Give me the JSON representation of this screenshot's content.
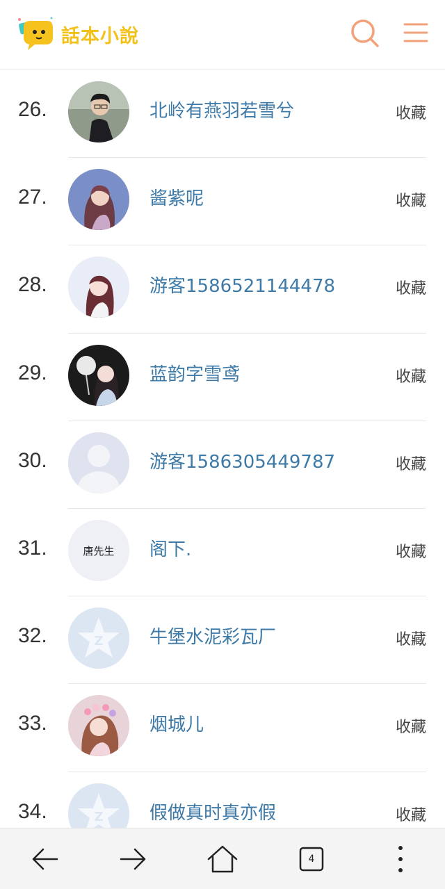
{
  "header": {
    "logo_text": "話本小說",
    "logo_icon": "speech-bubble-logo-icon",
    "search_icon": "search-icon",
    "menu_icon": "hamburger-menu-icon",
    "accent_color": "#f2a27a"
  },
  "list": {
    "collect_label": "收藏",
    "rows": [
      {
        "rank": "26.",
        "name": "北岭有燕羽若雪兮",
        "avatar": "photo-man"
      },
      {
        "rank": "27.",
        "name": "酱紫呢",
        "avatar": "photo-girl-pink"
      },
      {
        "rank": "28.",
        "name": "游客1586521144478",
        "avatar": "photo-girl-light"
      },
      {
        "rank": "29.",
        "name": "蓝韵字雪鸢",
        "avatar": "photo-girl-fan"
      },
      {
        "rank": "30.",
        "name": "游客1586305449787",
        "avatar": "default-person"
      },
      {
        "rank": "31.",
        "name": "阁下.",
        "avatar": "text-avatar",
        "avatar_text": "唐先生"
      },
      {
        "rank": "32.",
        "name": "牛堡水泥彩瓦厂",
        "avatar": "qzone-star"
      },
      {
        "rank": "33.",
        "name": "烟城儿",
        "avatar": "photo-girl-flowers"
      },
      {
        "rank": "34.",
        "name": "假做真时真亦假",
        "avatar": "qzone-star"
      }
    ]
  },
  "bottombar": {
    "back_icon": "arrow-left-icon",
    "forward_icon": "arrow-right-icon",
    "home_icon": "home-icon",
    "tabs_count": "4",
    "more_icon": "more-vertical-icon"
  }
}
